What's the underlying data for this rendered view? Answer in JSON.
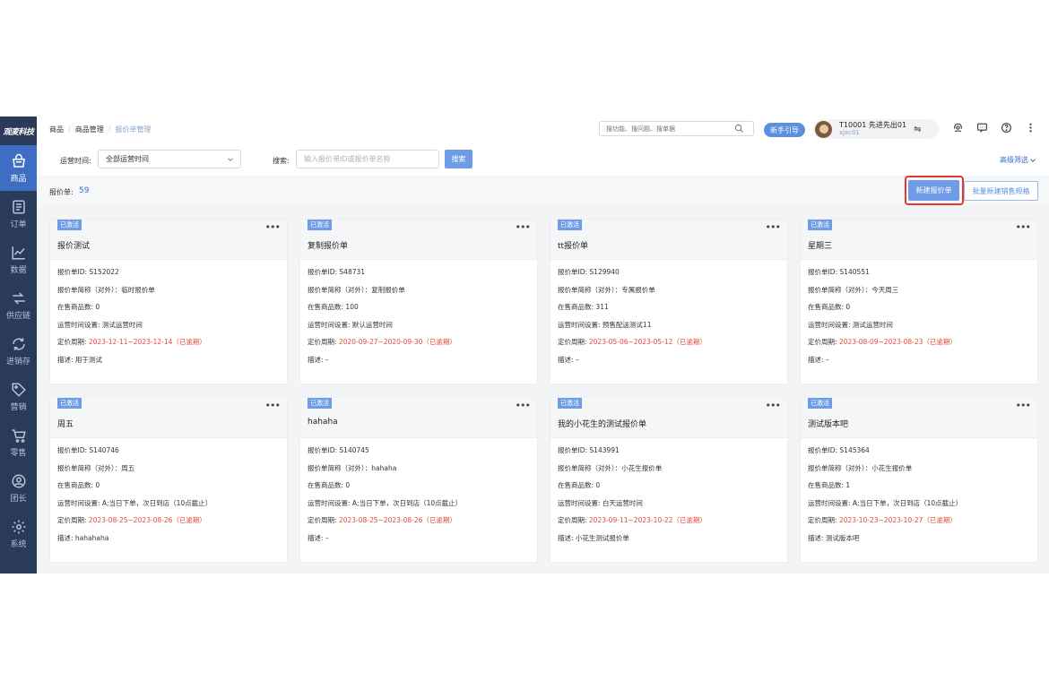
{
  "sidebar": {
    "logo": "观麦科技",
    "items": [
      {
        "label": "商品",
        "icon": "shopping-basket-icon",
        "active": true
      },
      {
        "label": "订单",
        "icon": "document-icon"
      },
      {
        "label": "数据",
        "icon": "line-chart-icon"
      },
      {
        "label": "供应链",
        "icon": "supply-chain-icon"
      },
      {
        "label": "进销存",
        "icon": "inventory-cycle-icon"
      },
      {
        "label": "营销",
        "icon": "tag-icon"
      },
      {
        "label": "零售",
        "icon": "cart-icon"
      },
      {
        "label": "团长",
        "icon": "person-icon"
      },
      {
        "label": "系统",
        "icon": "gear-icon"
      }
    ]
  },
  "header": {
    "breadcrumb": [
      "商品",
      "商品管理",
      "报价单管理"
    ],
    "search_placeholder": "搜功能、搜问题、搜单据",
    "guide_label": "新手引导",
    "user_name": "T10001 先进先出01",
    "user_id": "xjxc01",
    "swap_symbol": "⇋"
  },
  "filter": {
    "time_label": "运营时间:",
    "time_value": "全部运营时间",
    "search_label": "搜索:",
    "search_placeholder": "输入报价单ID或报价单名称",
    "search_button": "搜索",
    "advanced": "高级筛选"
  },
  "summary": {
    "count_label": "报价单:",
    "count_value": "59",
    "new_button": "新建报价单",
    "batch_button": "批量新建销售规格"
  },
  "labels": {
    "id": "报价单ID:",
    "short_name": "报价单简称（对外）：",
    "count": "在售商品数:",
    "time_setting": "运营时间设置:",
    "period": "定价周期:",
    "desc": "描述:"
  },
  "cards": [
    {
      "badge": "已激活",
      "title": "报价测试",
      "id": "S152022",
      "short_name": "临时报价单",
      "count": "0",
      "time_setting": "测试运营时间",
      "period": "2023-12-11~2023-12-14（已逾期）",
      "desc": "用于测试"
    },
    {
      "badge": "已激活",
      "title": "复制报价单",
      "id": "S48731",
      "short_name": "复制报价单",
      "count": "100",
      "time_setting": "默认运营时间",
      "period": "2020-09-27~2020-09-30（已逾期）",
      "desc": "–"
    },
    {
      "badge": "已激活",
      "title": "tt报价单",
      "id": "S129940",
      "short_name": "专属报价单",
      "count": "311",
      "time_setting": "预售配送测试11",
      "period": "2023-05-06~2023-05-12（已逾期）",
      "desc": "–"
    },
    {
      "badge": "已激活",
      "title": "星期三",
      "id": "S140551",
      "short_name": "今天周三",
      "count": "0",
      "time_setting": "测试运营时间",
      "period": "2023-08-09~2023-08-23（已逾期）",
      "desc": "–"
    },
    {
      "badge": "已激活",
      "title": "周五",
      "id": "S140746",
      "short_name": "周五",
      "count": "0",
      "time_setting": "A;当日下单，次日到店（10点截止）",
      "period": "2023-08-25~2023-08-26（已逾期）",
      "desc": "hahahaha"
    },
    {
      "badge": "已激活",
      "title": "hahaha",
      "id": "S140745",
      "short_name": "hahaha",
      "count": "0",
      "time_setting": "A;当日下单，次日到店（10点截止）",
      "period": "2023-08-25~2023-08-26（已逾期）",
      "desc": "–"
    },
    {
      "badge": "已激活",
      "title": "我的小花生的测试报价单",
      "id": "S143991",
      "short_name": "小花生报价单",
      "count": "0",
      "time_setting": "白天运营时间",
      "period": "2023-09-11~2023-10-22（已逾期）",
      "desc": "小花生测试报价单"
    },
    {
      "badge": "已激活",
      "title": "测试版本吧",
      "id": "S145364",
      "short_name": "小花生报价单",
      "count": "1",
      "time_setting": "A;当日下单，次日到店（10点截止）",
      "period": "2023-10-23~2023-10-27（已逾期）",
      "desc": "测试版本吧"
    }
  ],
  "colors": {
    "sidebar_bg": "#2a3a5a",
    "active": "#3d6ec4",
    "primary_button": "#6f9ce6",
    "overdue_red": "#e24b3b",
    "highlight_border": "#e03b2a"
  }
}
